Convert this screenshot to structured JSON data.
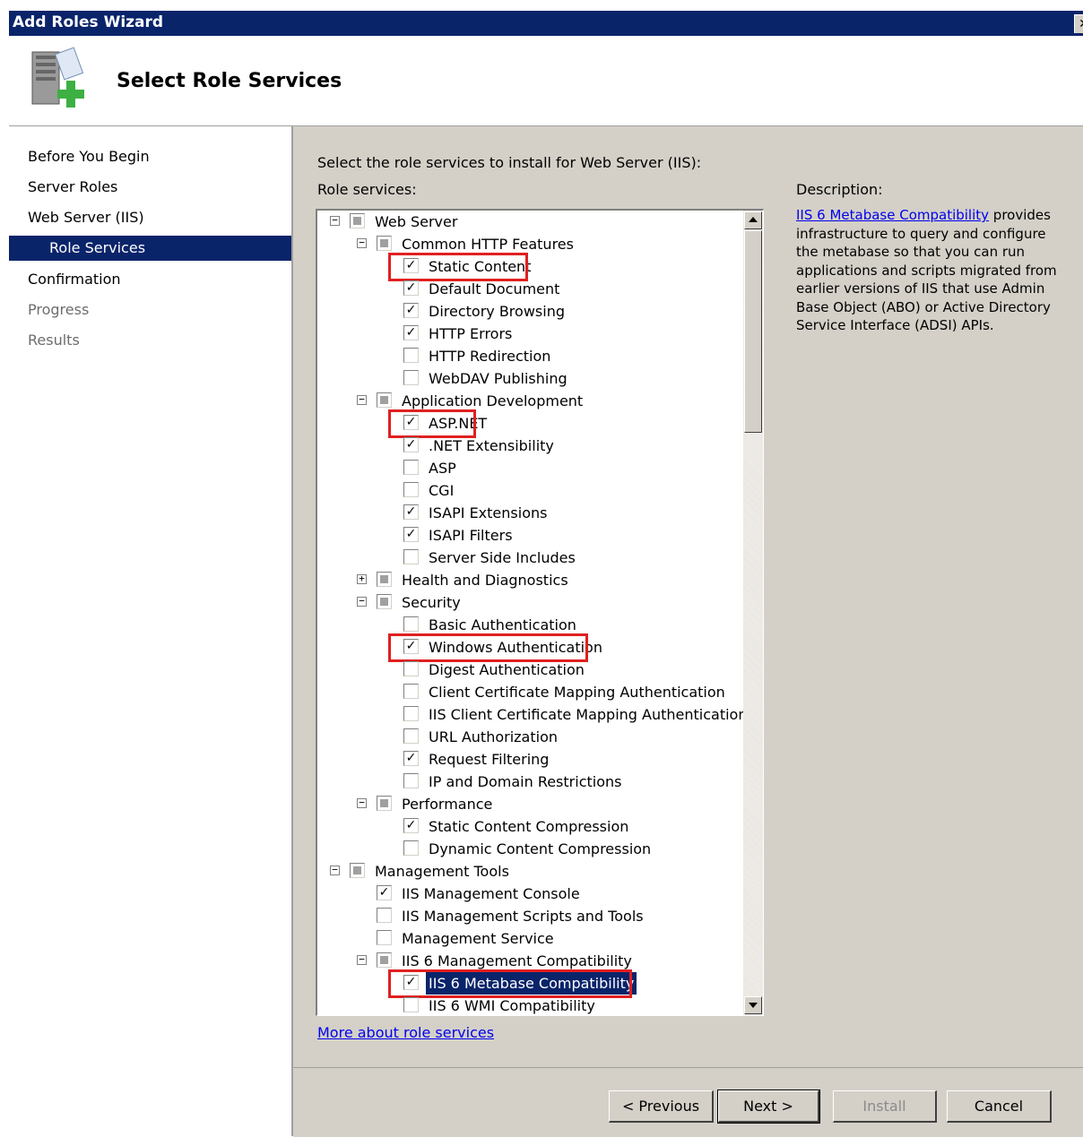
{
  "window": {
    "title": "Add Roles Wizard",
    "close_label": "✕"
  },
  "header": {
    "title": "Select Role Services"
  },
  "nav": [
    {
      "label": "Before You Begin",
      "state": "normal"
    },
    {
      "label": "Server Roles",
      "state": "normal"
    },
    {
      "label": "Web Server (IIS)",
      "state": "normal"
    },
    {
      "label": "Role Services",
      "state": "active"
    },
    {
      "label": "Confirmation",
      "state": "normal"
    },
    {
      "label": "Progress",
      "state": "disabled"
    },
    {
      "label": "Results",
      "state": "disabled"
    }
  ],
  "main": {
    "instruction": "Select the role services to install for Web Server (IIS):",
    "role_services_label": "Role services:",
    "description_label": "Description:",
    "description_link": "IIS 6 Metabase Compatibility",
    "description_text": " provides infrastructure to query and configure the metabase so that you can run applications and scripts migrated from earlier versions of IIS that use Admin Base Object (ABO) or Active Directory Service Interface (ADSI) APIs.",
    "more_link": "More about role services"
  },
  "tree": [
    {
      "label": "Web Server",
      "level": 0,
      "expander": "minus",
      "check": "partial"
    },
    {
      "label": "Common HTTP Features",
      "level": 1,
      "expander": "minus",
      "check": "partial"
    },
    {
      "label": "Static Content",
      "level": 2,
      "check": "checked",
      "highlight": true
    },
    {
      "label": "Default Document",
      "level": 2,
      "check": "checked"
    },
    {
      "label": "Directory Browsing",
      "level": 2,
      "check": "checked"
    },
    {
      "label": "HTTP Errors",
      "level": 2,
      "check": "checked"
    },
    {
      "label": "HTTP Redirection",
      "level": 2,
      "check": "unchecked"
    },
    {
      "label": "WebDAV Publishing",
      "level": 2,
      "check": "unchecked"
    },
    {
      "label": "Application Development",
      "level": 1,
      "expander": "minus",
      "check": "partial"
    },
    {
      "label": "ASP.NET",
      "level": 2,
      "check": "checked",
      "highlight": true
    },
    {
      "label": ".NET Extensibility",
      "level": 2,
      "check": "checked"
    },
    {
      "label": "ASP",
      "level": 2,
      "check": "unchecked"
    },
    {
      "label": "CGI",
      "level": 2,
      "check": "unchecked"
    },
    {
      "label": "ISAPI Extensions",
      "level": 2,
      "check": "checked"
    },
    {
      "label": "ISAPI Filters",
      "level": 2,
      "check": "checked"
    },
    {
      "label": "Server Side Includes",
      "level": 2,
      "check": "unchecked"
    },
    {
      "label": "Health and Diagnostics",
      "level": 1,
      "expander": "plus",
      "check": "partial"
    },
    {
      "label": "Security",
      "level": 1,
      "expander": "minus",
      "check": "partial"
    },
    {
      "label": "Basic Authentication",
      "level": 2,
      "check": "unchecked"
    },
    {
      "label": "Windows Authentication",
      "level": 2,
      "check": "checked",
      "highlight": true
    },
    {
      "label": "Digest Authentication",
      "level": 2,
      "check": "unchecked"
    },
    {
      "label": "Client Certificate Mapping Authentication",
      "level": 2,
      "check": "unchecked"
    },
    {
      "label": "IIS Client Certificate Mapping Authentication",
      "level": 2,
      "check": "unchecked"
    },
    {
      "label": "URL Authorization",
      "level": 2,
      "check": "unchecked"
    },
    {
      "label": "Request Filtering",
      "level": 2,
      "check": "checked"
    },
    {
      "label": "IP and Domain Restrictions",
      "level": 2,
      "check": "unchecked"
    },
    {
      "label": "Performance",
      "level": 1,
      "expander": "minus",
      "check": "partial"
    },
    {
      "label": "Static Content Compression",
      "level": 2,
      "check": "checked"
    },
    {
      "label": "Dynamic Content Compression",
      "level": 2,
      "check": "unchecked"
    },
    {
      "label": "Management Tools",
      "level": 0,
      "expander": "minus",
      "check": "partial"
    },
    {
      "label": "IIS Management Console",
      "level": 1,
      "check": "checked"
    },
    {
      "label": "IIS Management Scripts and Tools",
      "level": 1,
      "check": "unchecked"
    },
    {
      "label": "Management Service",
      "level": 1,
      "check": "unchecked"
    },
    {
      "label": "IIS 6 Management Compatibility",
      "level": 1,
      "expander": "minus",
      "check": "partial"
    },
    {
      "label": "IIS 6 Metabase Compatibility",
      "level": 2,
      "check": "checked",
      "highlight": true,
      "selected": true
    },
    {
      "label": "IIS 6 WMI Compatibility",
      "level": 2,
      "check": "unchecked"
    }
  ],
  "buttons": {
    "previous": "< Previous",
    "next": "Next >",
    "install": "Install",
    "cancel": "Cancel"
  },
  "colors": {
    "titlebar": "#0a246a",
    "highlight_box": "#e02020",
    "link": "#0000ee",
    "dialog_bg": "#d4d0c8"
  }
}
